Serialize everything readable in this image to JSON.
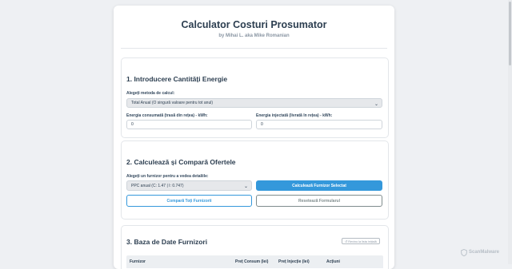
{
  "header": {
    "title": "Calculator Costuri Prosumator",
    "subtitle": "by Mihai L. aka Mike Romanian"
  },
  "section1": {
    "title": "1. Introducere Cantități Energie",
    "method_label": "Alegeți metoda de calcul:",
    "method_value": "Total Anual (O singură valoare pentru tot anul)",
    "consumed_label": "Energia consumată (trasă din rețea) - kWh:",
    "consumed_value": "0",
    "injected_label": "Energia injectată (livrată în rețea) - kWh:",
    "injected_value": "0"
  },
  "section2": {
    "title": "2. Calculează și Compară Ofertele",
    "supplier_label": "Alegeți un furnizor pentru a vedea detaliile:",
    "supplier_value": "PPC anual (C: 1.47 | I: 0.747)",
    "calc_button": "Calculează Furnizor Selectat",
    "compare_button": "Compară Toți Furnizorii",
    "reset_button": "Resetează Formularul"
  },
  "section3": {
    "title": "3. Baza de Date Furnizori",
    "revert_button": "↺ Revino la lista inițială",
    "columns": [
      "Furnizor",
      "Preț Consum (lei)",
      "Preț Injecție (lei)",
      "Acțiuni"
    ]
  },
  "watermark": {
    "text": "ScanMalware",
    "icon": "shield-icon"
  },
  "colors": {
    "accent": "#3498db",
    "title": "#2c3e50",
    "muted": "#7f8c8d"
  }
}
